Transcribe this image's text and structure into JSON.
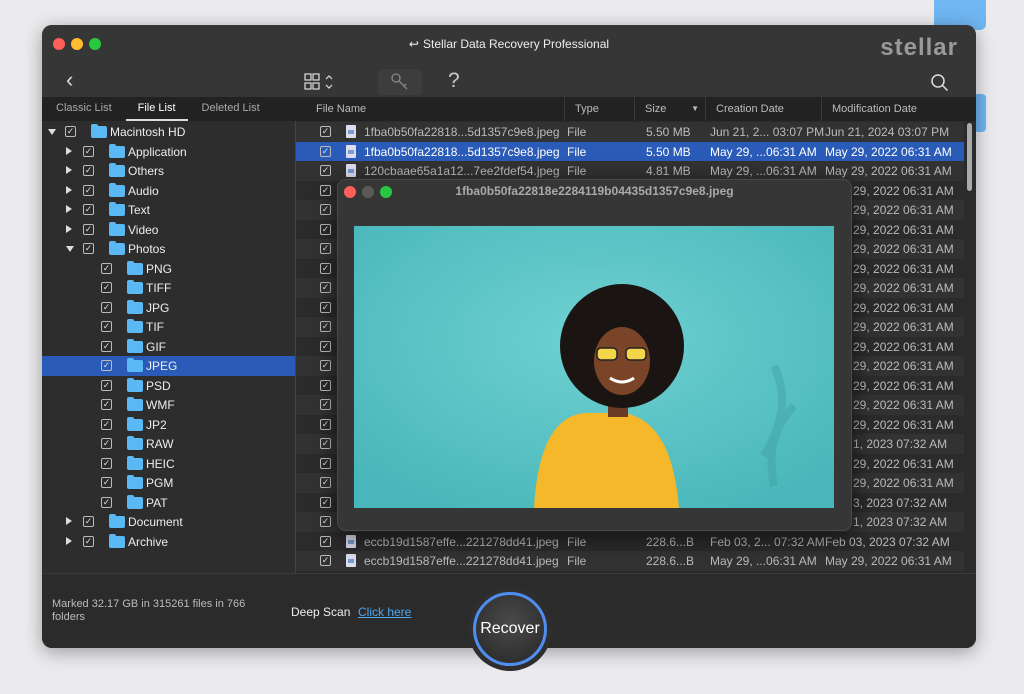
{
  "window": {
    "title": "Stellar Data Recovery Professional",
    "logo": "stellar"
  },
  "toolbar": {
    "back_icon": "chevron-left-icon",
    "view_icon": "grid-view-icon",
    "key_icon": "key-icon",
    "help": "?",
    "search_icon": "search-icon"
  },
  "tabs": [
    {
      "label": "Classic List"
    },
    {
      "label": "File List",
      "active": true
    },
    {
      "label": "Deleted List"
    }
  ],
  "columns": {
    "name": "File Name",
    "type": "Type",
    "size": "Size",
    "created": "Creation Date",
    "modified": "Modification Date"
  },
  "tree": [
    {
      "label": "Macintosh HD",
      "level": 0,
      "expand": "down"
    },
    {
      "label": "Application",
      "level": 1,
      "expand": "right"
    },
    {
      "label": "Others",
      "level": 1,
      "expand": "right"
    },
    {
      "label": "Audio",
      "level": 1,
      "expand": "right"
    },
    {
      "label": "Text",
      "level": 1,
      "expand": "right"
    },
    {
      "label": "Video",
      "level": 1,
      "expand": "right"
    },
    {
      "label": "Photos",
      "level": 1,
      "expand": "down"
    },
    {
      "label": "PNG",
      "level": 2
    },
    {
      "label": "TIFF",
      "level": 2
    },
    {
      "label": "JPG",
      "level": 2
    },
    {
      "label": "TIF",
      "level": 2
    },
    {
      "label": "GIF",
      "level": 2
    },
    {
      "label": "JPEG",
      "level": 2,
      "selected": true
    },
    {
      "label": "PSD",
      "level": 2
    },
    {
      "label": "WMF",
      "level": 2
    },
    {
      "label": "JP2",
      "level": 2
    },
    {
      "label": "RAW",
      "level": 2
    },
    {
      "label": "HEIC",
      "level": 2
    },
    {
      "label": "PGM",
      "level": 2
    },
    {
      "label": "PAT",
      "level": 2
    },
    {
      "label": "Document",
      "level": 1,
      "expand": "right"
    },
    {
      "label": "Archive",
      "level": 1,
      "expand": "right"
    }
  ],
  "rows_top": [
    {
      "name": "1fba0b50fa22818...5d1357c9e8.jpeg",
      "type": "File",
      "size": "5.50 MB",
      "created": "Jun 21, 2... 03:07 PM",
      "modified": "Jun 21, 2024 03:07 PM"
    },
    {
      "name": "1fba0b50fa22818...5d1357c9e8.jpeg",
      "type": "File",
      "size": "5.50 MB",
      "created": "May 29, ...06:31 AM",
      "modified": "May 29, 2022 06:31 AM",
      "selected": true
    },
    {
      "name": "120cbaae65a1a12...7ee2fdef54.jpeg",
      "type": "File",
      "size": "4.81 MB",
      "created": "May 29, ...06:31 AM",
      "modified": "May 29, 2022 06:31 AM"
    }
  ],
  "rows_obscured_modified": [
    "29, 2022 06:31 AM",
    "29, 2022 06:31 AM",
    "29, 2022 06:31 AM",
    "29, 2022 06:31 AM",
    "29, 2022 06:31 AM",
    "29, 2022 06:31 AM",
    "29, 2022 06:31 AM",
    "29, 2022 06:31 AM",
    "29, 2022 06:31 AM",
    "29, 2022 06:31 AM",
    "29, 2022 06:31 AM",
    "29, 2022 06:31 AM",
    "29, 2022 06:31 AM",
    "1, 2023 07:32 AM",
    "29, 2022 06:31 AM",
    "29, 2022 06:31 AM",
    "3, 2023 07:32 AM",
    "1, 2023 07:32 AM"
  ],
  "rows_bottom": [
    {
      "name": "eccb19d1587effe...221278dd41.jpeg",
      "type": "File",
      "size": "228.6...B",
      "created": "Feb 03, 2... 07:32 AM",
      "modified": "Feb 03, 2023 07:32 AM"
    },
    {
      "name": "eccb19d1587effe...221278dd41.jpeg",
      "type": "File",
      "size": "228.6...B",
      "created": "May 29, ...06:31 AM",
      "modified": "May 29, 2022 06:31 AM"
    }
  ],
  "preview": {
    "title": "1fba0b50fa22818e2284119b04435d1357c9e8.jpeg"
  },
  "footer": {
    "status": "Marked 32.17 GB in 315261 files in 766 folders",
    "deep_scan": "Deep Scan",
    "click_here": "Click here",
    "recover": "Recover"
  },
  "colors": {
    "accent": "#2a5bb8",
    "folder": "#5ab8f5",
    "link": "#4fa8f0",
    "recover_ring": "#4d8ef0"
  }
}
